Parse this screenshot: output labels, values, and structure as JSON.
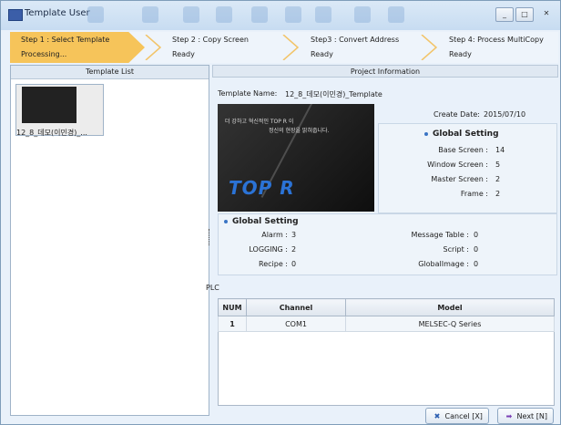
{
  "window": {
    "title": "Template User",
    "icon": "app-icon",
    "controls": [
      "_",
      "□",
      "✕"
    ]
  },
  "steps": [
    {
      "label": "Step 1 : Select Template",
      "status": "Processing...",
      "active": true
    },
    {
      "label": "Step 2 : Copy Screen",
      "status": "Ready",
      "active": false
    },
    {
      "label": "Step3 : Convert Address",
      "status": "Ready",
      "active": false
    },
    {
      "label": "Step 4: Process MultiCopy",
      "status": "Ready",
      "active": false
    }
  ],
  "template_list": {
    "header": "Template List",
    "items": [
      {
        "name": "12_8_데모(이민경)_..."
      }
    ]
  },
  "project_info": {
    "header": "Project Information",
    "template_name_label": "Template Name:",
    "template_name_value": "12_8_데모(이민경)_Template",
    "create_date_label": "Create Date:",
    "create_date_value": "2015/07/10",
    "preview": {
      "tagline1": "더 강하고 혁신적인 TOP R 이",
      "tagline2": "정신의 현장을 밝혀줍니다.",
      "logo": "TOP R"
    },
    "global_setting_1": {
      "title": "Global Setting",
      "items": [
        {
          "label": "Base Screen :",
          "value": "14"
        },
        {
          "label": "Window Screen :",
          "value": "5"
        },
        {
          "label": "Master Screen :",
          "value": "2"
        },
        {
          "label": "Frame :",
          "value": "2"
        }
      ]
    },
    "global_setting_2": {
      "title": "Global Setting",
      "left": [
        {
          "label": "Alarm :",
          "value": "3"
        },
        {
          "label": "LOGGING :",
          "value": "2"
        },
        {
          "label": "Recipe :",
          "value": "0"
        }
      ],
      "right": [
        {
          "label": "Message Table :",
          "value": "0"
        },
        {
          "label": "Script :",
          "value": "0"
        },
        {
          "label": "GlobalImage :",
          "value": "0"
        }
      ]
    },
    "plc": {
      "label": "PLC",
      "columns": [
        "NUM",
        "Channel",
        "Model"
      ],
      "rows": [
        {
          "num": "1",
          "channel": "COM1",
          "model": "MELSEC-Q Series"
        }
      ]
    }
  },
  "buttons": {
    "cancel": "Cancel [X]",
    "next": "Next [N]"
  },
  "colors": {
    "active_step": "#f6c45a",
    "accent": "#3a74c4",
    "cancel_icon": "#2a5db0",
    "next_icon": "#7a3fb5"
  }
}
